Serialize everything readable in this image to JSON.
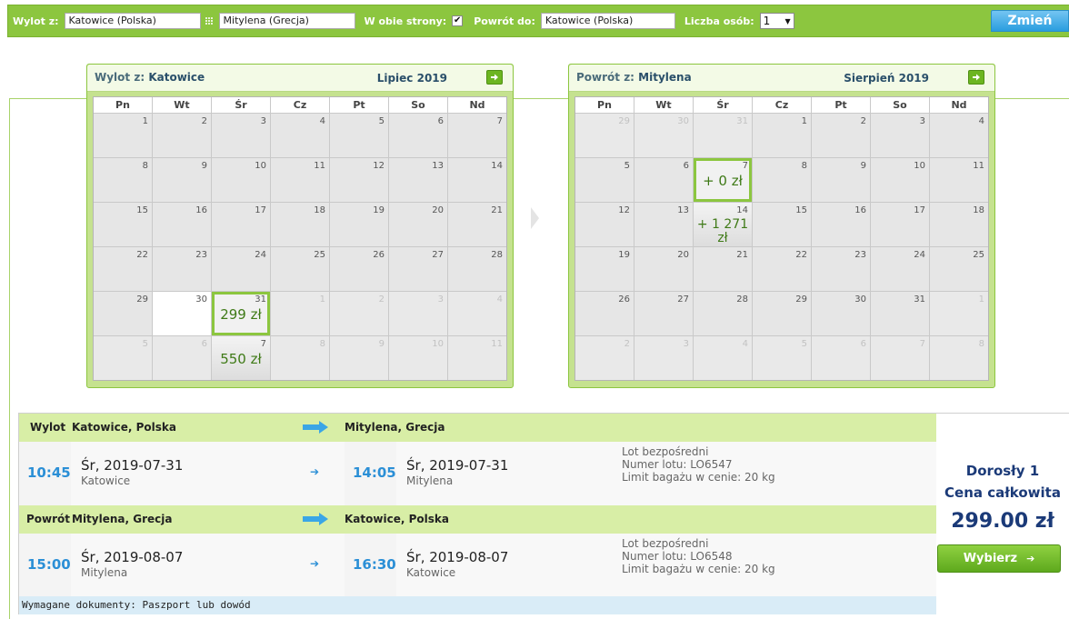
{
  "search": {
    "from_label": "Wylot z:",
    "from_value": "Katowice (Polska)",
    "to_value": "Mitylena (Grecja)",
    "roundtrip_label": "W obie strony:",
    "roundtrip_checked": "✔",
    "return_label": "Powrót do:",
    "return_value": "Katowice (Polska)",
    "persons_label": "Liczba osób:",
    "persons_value": "1",
    "change_button": "Zmień"
  },
  "outbound_calendar": {
    "title_prefix": "Wylot z:",
    "city": "Katowice",
    "month": "Lipiec 2019",
    "weekdays": [
      "Pn",
      "Wt",
      "Śr",
      "Cz",
      "Pt",
      "So",
      "Nd"
    ],
    "days": [
      {
        "n": "1"
      },
      {
        "n": "2"
      },
      {
        "n": "3"
      },
      {
        "n": "4"
      },
      {
        "n": "5"
      },
      {
        "n": "6"
      },
      {
        "n": "7"
      },
      {
        "n": "8"
      },
      {
        "n": "9"
      },
      {
        "n": "10"
      },
      {
        "n": "11"
      },
      {
        "n": "12"
      },
      {
        "n": "13"
      },
      {
        "n": "14"
      },
      {
        "n": "15"
      },
      {
        "n": "16"
      },
      {
        "n": "17"
      },
      {
        "n": "18"
      },
      {
        "n": "19"
      },
      {
        "n": "20"
      },
      {
        "n": "21"
      },
      {
        "n": "22"
      },
      {
        "n": "23"
      },
      {
        "n": "24"
      },
      {
        "n": "25"
      },
      {
        "n": "26"
      },
      {
        "n": "27"
      },
      {
        "n": "28"
      },
      {
        "n": "29"
      },
      {
        "n": "30",
        "style": "white"
      },
      {
        "n": "31",
        "price": "299 zł",
        "style": "sel"
      },
      {
        "n": "1",
        "style": "muted"
      },
      {
        "n": "2",
        "style": "muted"
      },
      {
        "n": "3",
        "style": "muted"
      },
      {
        "n": "4",
        "style": "muted"
      },
      {
        "n": "5",
        "style": "muted"
      },
      {
        "n": "6",
        "style": "muted"
      },
      {
        "n": "7",
        "price": "550 zł",
        "style": "priced"
      },
      {
        "n": "8",
        "style": "muted"
      },
      {
        "n": "9",
        "style": "muted"
      },
      {
        "n": "10",
        "style": "muted"
      },
      {
        "n": "11",
        "style": "muted"
      }
    ]
  },
  "return_calendar": {
    "title_prefix": "Powrót z:",
    "city": "Mitylena",
    "month": "Sierpień 2019",
    "weekdays": [
      "Pn",
      "Wt",
      "Śr",
      "Cz",
      "Pt",
      "So",
      "Nd"
    ],
    "days": [
      {
        "n": "29",
        "style": "muted"
      },
      {
        "n": "30",
        "style": "muted"
      },
      {
        "n": "31",
        "style": "muted"
      },
      {
        "n": "1"
      },
      {
        "n": "2"
      },
      {
        "n": "3"
      },
      {
        "n": "4"
      },
      {
        "n": "5"
      },
      {
        "n": "6"
      },
      {
        "n": "7",
        "price": "+ 0 zł",
        "style": "sel"
      },
      {
        "n": "8"
      },
      {
        "n": "9"
      },
      {
        "n": "10"
      },
      {
        "n": "11"
      },
      {
        "n": "12"
      },
      {
        "n": "13"
      },
      {
        "n": "14",
        "price": "+ 1 271 zł",
        "style": "priced"
      },
      {
        "n": "15"
      },
      {
        "n": "16"
      },
      {
        "n": "17"
      },
      {
        "n": "18"
      },
      {
        "n": "19"
      },
      {
        "n": "20"
      },
      {
        "n": "21"
      },
      {
        "n": "22"
      },
      {
        "n": "23"
      },
      {
        "n": "24"
      },
      {
        "n": "25"
      },
      {
        "n": "26"
      },
      {
        "n": "27"
      },
      {
        "n": "28"
      },
      {
        "n": "29"
      },
      {
        "n": "30"
      },
      {
        "n": "31"
      },
      {
        "n": "1",
        "style": "muted"
      },
      {
        "n": "2",
        "style": "muted"
      },
      {
        "n": "3",
        "style": "muted"
      },
      {
        "n": "4",
        "style": "muted"
      },
      {
        "n": "5",
        "style": "muted"
      },
      {
        "n": "6",
        "style": "muted"
      },
      {
        "n": "7",
        "style": "muted"
      },
      {
        "n": "8",
        "style": "muted"
      }
    ]
  },
  "outbound": {
    "label": "Wylot",
    "from": "Katowice, Polska",
    "to": "Mitylena, Grecja",
    "dep_time": "10:45",
    "dep_date": "Śr, 2019-07-31",
    "dep_city": "Katowice",
    "arr_time": "14:05",
    "arr_date": "Śr, 2019-07-31",
    "arr_city": "Mitylena",
    "info1": "Lot bezpośredni",
    "info2": "Numer lotu: LO6547",
    "info3": "Limit bagażu w cenie: 20 kg"
  },
  "inbound": {
    "label": "Powrót",
    "from": "Mitylena, Grecja",
    "to": "Katowice, Polska",
    "dep_time": "15:00",
    "dep_date": "Śr, 2019-08-07",
    "dep_city": "Mitylena",
    "arr_time": "16:30",
    "arr_date": "Śr, 2019-08-07",
    "arr_city": "Katowice",
    "info1": "Lot bezpośredni",
    "info2": "Numer lotu: LO6548",
    "info3": "Limit bagażu w cenie: 20 kg"
  },
  "documents": "Wymagane dokumenty: Paszport lub dowód",
  "price": {
    "passengers": "Dorosły 1",
    "total_label": "Cena całkowita",
    "total": "299.00 zł",
    "select_button": "Wybierz"
  },
  "colors": {
    "brand_green": "#8cc63f",
    "accent_blue": "#2b8fd6",
    "price_navy": "#1b3a78"
  }
}
